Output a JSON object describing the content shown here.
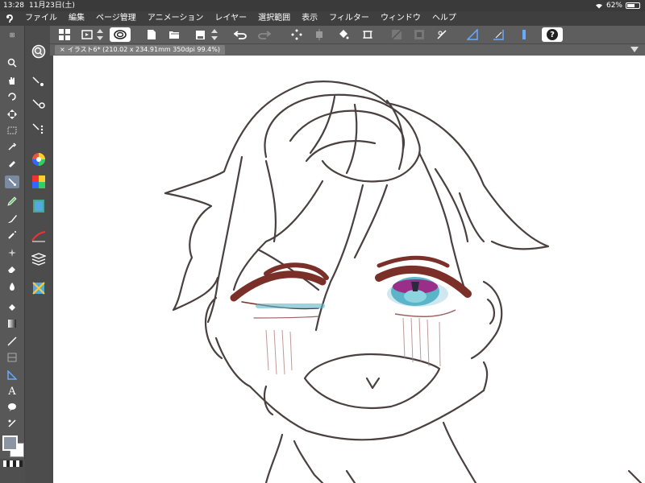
{
  "status_bar": {
    "time": "13:28",
    "date": "11月23日(土)",
    "battery": "62%",
    "battery_level": 0.62
  },
  "menu": {
    "items": [
      "ファイル",
      "編集",
      "ページ管理",
      "アニメーション",
      "レイヤー",
      "選択範囲",
      "表示",
      "フィルター",
      "ウィンドウ",
      "ヘルプ"
    ]
  },
  "canvas_tab": {
    "title": "イラスト6* (210.02 x 234.91mm 350dpi 99.4%)"
  },
  "tools": [
    "zoom",
    "hand",
    "rotate",
    "move",
    "select-rect",
    "auto-select",
    "eyedropper",
    "pen",
    "pencil",
    "brush",
    "airbrush",
    "decoration",
    "eraser",
    "blend",
    "fill",
    "gradient",
    "figure",
    "frame",
    "ruler",
    "text",
    "balloon",
    "correct-line"
  ],
  "toolbar": {
    "help_label": "?"
  },
  "colors": {
    "accent": "#7a8aa0",
    "line": "#4a4040",
    "lid": "#7a3028",
    "eye": "#5ab5c8"
  }
}
